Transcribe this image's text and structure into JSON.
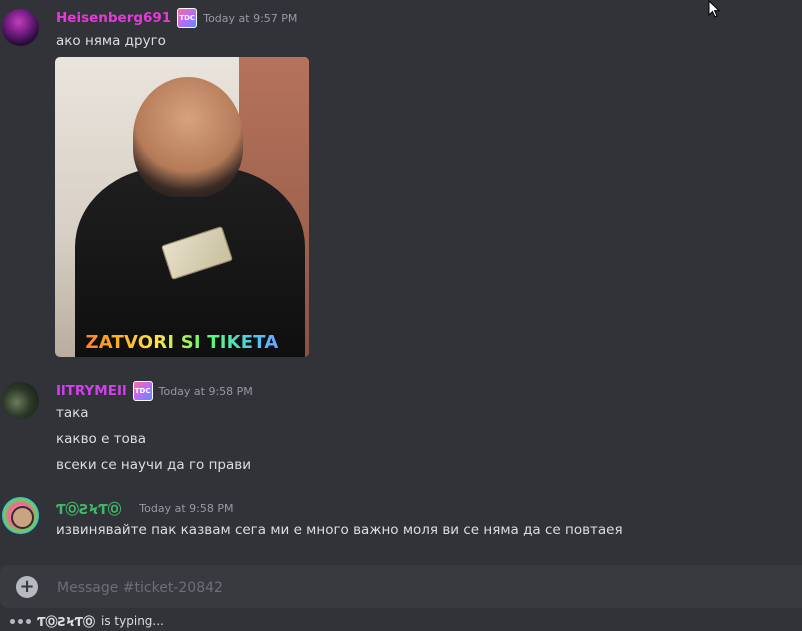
{
  "messages": [
    {
      "author": "Heisenberg691",
      "badge": "TDC",
      "timestamp": "Today at 9:57 PM",
      "lines": [
        "ако няма друго"
      ],
      "attachment": {
        "caption": "ZATVORI SI TIKETA"
      }
    },
    {
      "author": "IlTRYMEIl",
      "badge": "TDC",
      "timestamp": "Today at 9:58 PM",
      "lines": [
        "така",
        "какво е това",
        "всеки се научи да го прави"
      ]
    },
    {
      "author": "ƬⓄƧϞƬⓄ",
      "timestamp": "Today at 9:58 PM",
      "lines": [
        "извинявайте пак казвам сега ми е много важно моля ви се няма да се повтаея"
      ]
    }
  ],
  "composer": {
    "placeholder": "Message #ticket-20842"
  },
  "typing": {
    "user": "ƬⓄƧϞƬⓄ",
    "suffix": "is typing..."
  },
  "colors": {
    "background": "#313338",
    "input_bar": "#383a40",
    "author1": "#e43bd8",
    "author2": "#d43ef0",
    "author3": "#3fb86a"
  }
}
